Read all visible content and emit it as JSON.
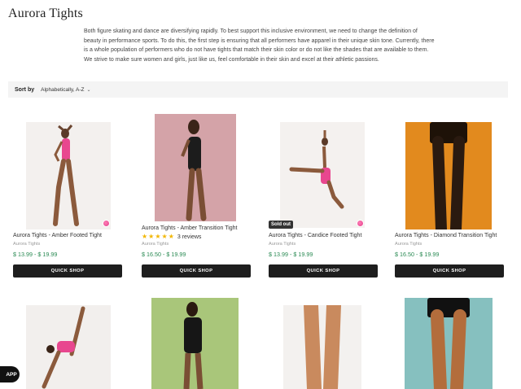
{
  "page": {
    "title": "Aurora Tights",
    "intro": "Both figure skating and dance are diversifying rapidly. To best support this inclusive environment, we need to change the definition of beauty in performance sports. To do this, the first step is ensuring that all performers have apparel in their unique skin tone. Currently, there is a whole population of performers who do not have tights that match their skin color or do not like the shades that are available to them. We strive to make sure women and girls, just like us, feel comfortable in their skin and excel at their athletic passions."
  },
  "sort": {
    "label": "Sort by",
    "selected": "Alphabetically, A-Z",
    "chevron_icon": "chevron-down-icon"
  },
  "products": [
    {
      "title": "Aurora Tights - Amber Footed Tight",
      "brand": "Aurora Tights",
      "price": "$ 13.99 - $ 19.99",
      "button": "QUICK SHOP",
      "swatch_color": "#e94b93",
      "photo_bg": "#f3f0ee"
    },
    {
      "title": "Aurora Tights - Amber Transition Tight",
      "brand": "Aurora Tights",
      "price": "$ 16.50 - $ 19.99",
      "button": "QUICK SHOP",
      "rating_stars": 5,
      "reviews": "3 reviews",
      "photo_bg": "#d4a3a8"
    },
    {
      "title": "Aurora Tights - Candice Footed Tight",
      "brand": "Aurora Tights",
      "price": "$ 13.99 - $ 19.99",
      "button": "QUICK SHOP",
      "badge": "Sold out",
      "swatch_color": "#e94b93",
      "photo_bg": "#f4f1ef"
    },
    {
      "title": "Aurora Tights - Diamond Transition Tight",
      "brand": "Aurora Tights",
      "price": "$ 16.50 - $ 19.99",
      "button": "QUICK SHOP",
      "photo_bg": "#e28a1e"
    }
  ],
  "second_row_photo_bgs": [
    "#f2efed",
    "#a9c67a",
    "#f3f1ef",
    "#86c0bf"
  ],
  "app_button": "APP",
  "colors": {
    "price_green": "#2a8a53",
    "button_dark": "#1e1e1e",
    "star_gold": "#f2b600"
  }
}
